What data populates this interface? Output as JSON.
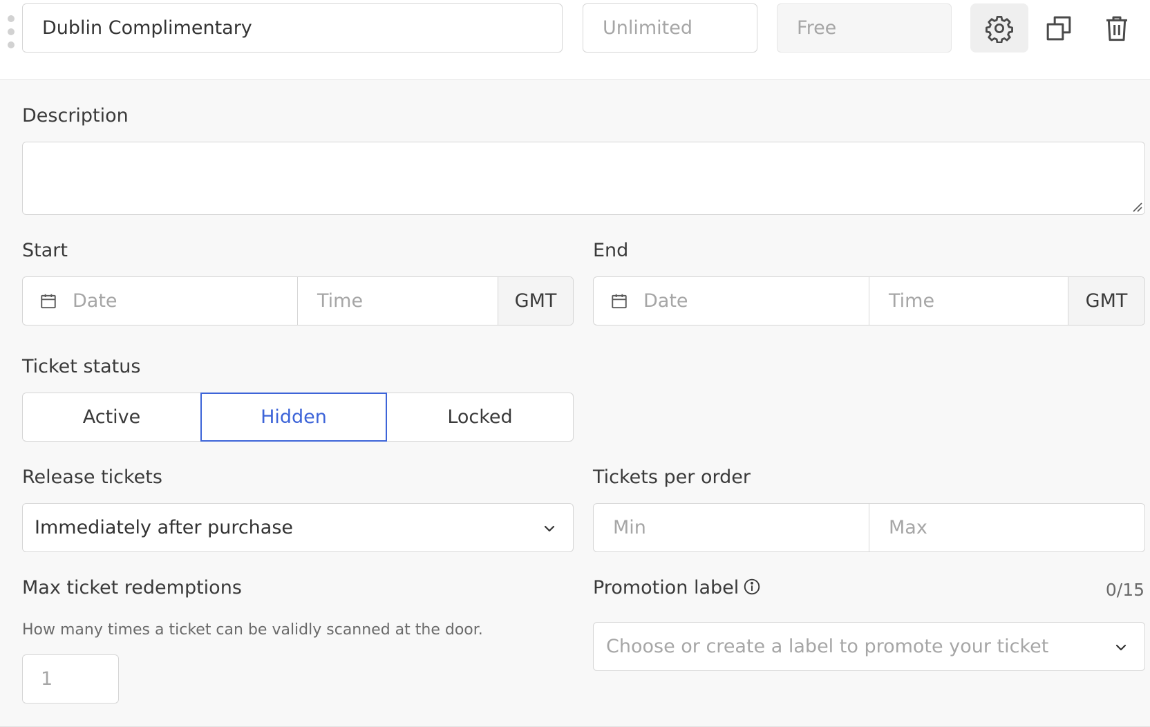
{
  "ticket": {
    "name": "Dublin Complimentary",
    "quantity_placeholder": "Unlimited",
    "price_placeholder": "Free"
  },
  "actions": {
    "settings_icon": "gear-icon",
    "duplicate_icon": "copy-icon",
    "delete_icon": "trash-icon"
  },
  "description": {
    "label": "Description",
    "value": ""
  },
  "start": {
    "label": "Start",
    "date_placeholder": "Date",
    "time_placeholder": "Time",
    "timezone": "GMT"
  },
  "end": {
    "label": "End",
    "date_placeholder": "Date",
    "time_placeholder": "Time",
    "timezone": "GMT"
  },
  "ticket_status": {
    "label": "Ticket status",
    "options": [
      "Active",
      "Hidden",
      "Locked"
    ],
    "selected": "Hidden"
  },
  "release_tickets": {
    "label": "Release tickets",
    "value": "Immediately after purchase"
  },
  "tickets_per_order": {
    "label": "Tickets per order",
    "min_placeholder": "Min",
    "max_placeholder": "Max"
  },
  "max_redemptions": {
    "label": "Max ticket redemptions",
    "help": "How many times a ticket can be validly scanned at the door.",
    "value_placeholder": "1"
  },
  "promotion_label": {
    "label": "Promotion label",
    "counter": "0/15",
    "placeholder": "Choose or create a label to promote your ticket"
  },
  "colors": {
    "accent": "#3d64d8",
    "panel_bg": "#f8f8f8",
    "border": "#d6d6d6"
  }
}
